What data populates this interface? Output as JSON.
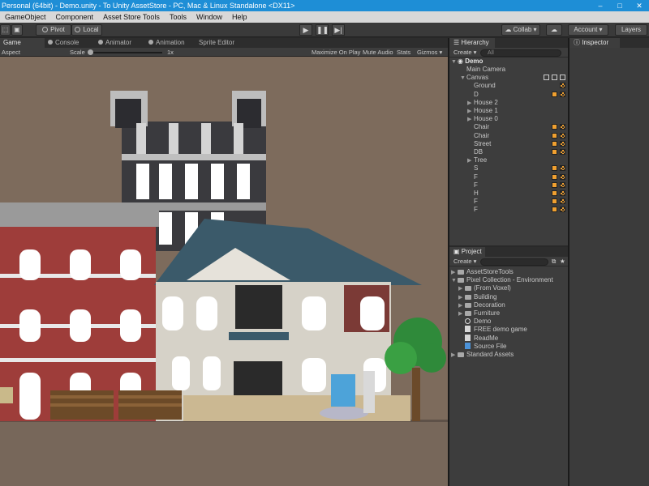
{
  "window": {
    "title": "Personal (64bit) - Demo.unity - To Unity AssetStore - PC, Mac & Linux Standalone <DX11>"
  },
  "menu": [
    "GameObject",
    "Component",
    "Asset Store Tools",
    "Tools",
    "Window",
    "Help"
  ],
  "toolbar": {
    "pivot": "Pivot",
    "local": "Local",
    "collab": "Collab ▾",
    "account": "Account",
    "layers": "Layers"
  },
  "game_tabs": [
    "Game",
    "Console",
    "Animator",
    "Animation",
    "Sprite Editor"
  ],
  "game_toolbar": {
    "aspect": "Aspect",
    "scale_label": "Scale",
    "scale_value": "1x",
    "maximize": "Maximize On Play",
    "mute": "Mute Audio",
    "stats": "Stats",
    "gizmos": "Gizmos ▾"
  },
  "hierarchy": {
    "tab": "Hierarchy",
    "create": "Create ▾",
    "search_placeholder": "All",
    "scene": "Demo",
    "items": [
      {
        "label": "Main Camera",
        "depth": 1,
        "arrow": ""
      },
      {
        "label": "Canvas",
        "depth": 1,
        "arrow": "▼"
      },
      {
        "label": "Ground",
        "depth": 2,
        "arrow": ""
      },
      {
        "label": "D",
        "depth": 2,
        "arrow": ""
      },
      {
        "label": "House 2",
        "depth": 2,
        "arrow": "▶"
      },
      {
        "label": "House 1",
        "depth": 2,
        "arrow": "▶"
      },
      {
        "label": "House 0",
        "depth": 2,
        "arrow": "▶"
      },
      {
        "label": "Chair",
        "depth": 2,
        "arrow": ""
      },
      {
        "label": "Chair",
        "depth": 2,
        "arrow": ""
      },
      {
        "label": "Street",
        "depth": 2,
        "arrow": ""
      },
      {
        "label": "DB",
        "depth": 2,
        "arrow": ""
      },
      {
        "label": "Tree",
        "depth": 2,
        "arrow": "▶"
      },
      {
        "label": "S",
        "depth": 2,
        "arrow": ""
      },
      {
        "label": "F",
        "depth": 2,
        "arrow": ""
      },
      {
        "label": "F",
        "depth": 2,
        "arrow": ""
      },
      {
        "label": "H",
        "depth": 2,
        "arrow": ""
      },
      {
        "label": "F",
        "depth": 2,
        "arrow": ""
      },
      {
        "label": "F",
        "depth": 2,
        "arrow": ""
      }
    ]
  },
  "inspector": {
    "tab": "Inspector"
  },
  "project": {
    "tab": "Project",
    "create": "Create ▾",
    "items": [
      {
        "label": "AssetStoreTools",
        "depth": 0,
        "arrow": "▶",
        "icon": "folder"
      },
      {
        "label": "Pixel Collection - Environment",
        "depth": 0,
        "arrow": "▼",
        "icon": "folder"
      },
      {
        "label": "(From Voxel)",
        "depth": 1,
        "arrow": "▶",
        "icon": "folder"
      },
      {
        "label": "Building",
        "depth": 1,
        "arrow": "▶",
        "icon": "folder"
      },
      {
        "label": "Decoration",
        "depth": 1,
        "arrow": "▶",
        "icon": "folder"
      },
      {
        "label": "Furniture",
        "depth": 1,
        "arrow": "▶",
        "icon": "folder"
      },
      {
        "label": "Demo",
        "depth": 1,
        "arrow": "",
        "icon": "scene"
      },
      {
        "label": "FREE demo game",
        "depth": 1,
        "arrow": "",
        "icon": "file"
      },
      {
        "label": "ReadMe",
        "depth": 1,
        "arrow": "",
        "icon": "file"
      },
      {
        "label": "Source File",
        "depth": 1,
        "arrow": "",
        "icon": "src"
      },
      {
        "label": "Standard Assets",
        "depth": 0,
        "arrow": "▶",
        "icon": "folder"
      }
    ]
  },
  "colors": {
    "titlebar": "#1e8ed6",
    "game_background": "#7d6b5c",
    "panel": "#3d3d3d",
    "accent_orange": "#f0a030"
  }
}
